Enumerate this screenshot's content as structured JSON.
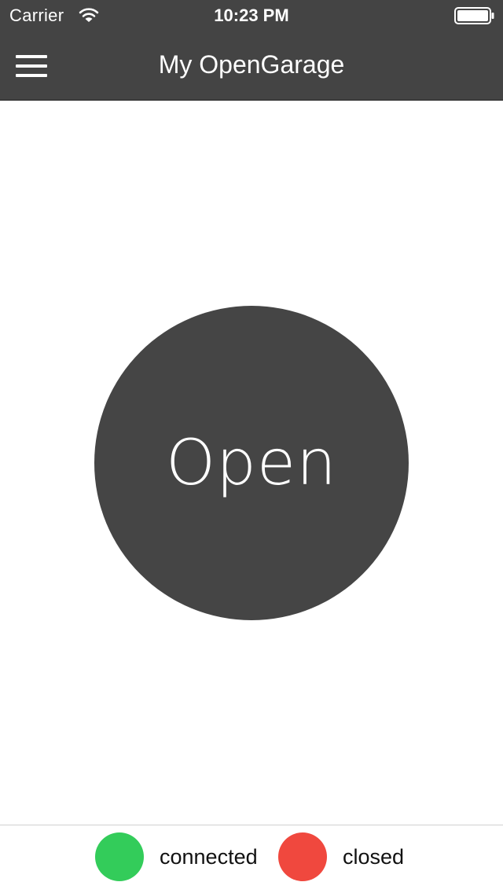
{
  "status_bar": {
    "carrier": "Carrier",
    "time": "10:23 PM",
    "wifi_icon": "wifi-icon",
    "battery_icon": "battery-icon"
  },
  "nav": {
    "title": "My OpenGarage",
    "menu_icon": "hamburger-menu-icon"
  },
  "main": {
    "button_label": "Open"
  },
  "footer": {
    "connection_status": "connected",
    "door_status": "closed"
  },
  "colors": {
    "header_background": "#444444",
    "button_background": "#454545",
    "connected_indicator": "#33cc5a",
    "closed_indicator": "#f0483e"
  }
}
